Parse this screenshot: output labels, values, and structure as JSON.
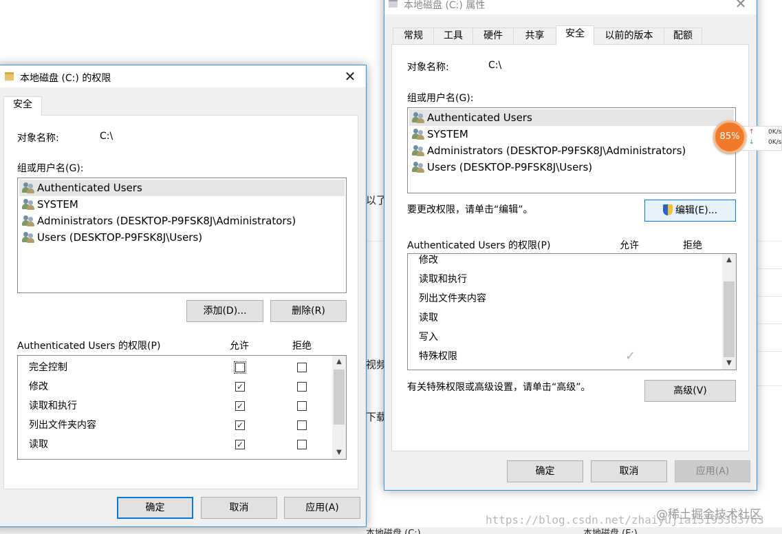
{
  "background": {
    "partial_texts": [
      "以了",
      "视频",
      "下载"
    ],
    "drives": [
      "本地磁盘 (C:)",
      "本地磁盘 (E:)"
    ],
    "watermark_url": "https://blog.csdn.net/zhaiyujia15195383763",
    "watermark_site": "@稀土掘金技术社区"
  },
  "network_widget": {
    "percent": "85%",
    "upload": "0K/s",
    "download": "0K/s",
    "up_arrow": "↑",
    "down_arrow": "↓"
  },
  "perm_dialog": {
    "title": "本地磁盘 (C:) 的权限",
    "close": "✕",
    "tab": "安全",
    "object_label": "对象名称:",
    "object_value": "C:\\",
    "group_label": "组或用户名(G):",
    "users": [
      "Authenticated Users",
      "SYSTEM",
      "Administrators (DESKTOP-P9FSK8J\\Administrators)",
      "Users (DESKTOP-P9FSK8J\\Users)"
    ],
    "add_button": "添加(D)...",
    "remove_button": "删除(R)",
    "perm_header": "Authenticated Users 的权限(P)",
    "allow_header": "允许",
    "deny_header": "拒绝",
    "permissions": [
      {
        "name": "完全控制",
        "allow": false,
        "deny": false
      },
      {
        "name": "修改",
        "allow": true,
        "deny": false
      },
      {
        "name": "读取和执行",
        "allow": true,
        "deny": false
      },
      {
        "name": "列出文件夹内容",
        "allow": true,
        "deny": false
      },
      {
        "name": "读取",
        "allow": true,
        "deny": false
      }
    ],
    "ok_button": "确定",
    "cancel_button": "取消",
    "apply_button": "应用(A)"
  },
  "props_dialog": {
    "title": "本地磁盘 (C:) 属性",
    "close": "✕",
    "tabs": [
      "常规",
      "工具",
      "硬件",
      "共享",
      "安全",
      "以前的版本",
      "配额"
    ],
    "active_tab": "安全",
    "object_label": "对象名称:",
    "object_value": "C:\\",
    "group_label": "组或用户名(G):",
    "users": [
      "Authenticated Users",
      "SYSTEM",
      "Administrators (DESKTOP-P9FSK8J\\Administrators)",
      "Users (DESKTOP-P9FSK8J\\Users)"
    ],
    "change_hint": "要更改权限，请单击“编辑”。",
    "edit_button": "编辑(E)...",
    "perm_header": "Authenticated Users 的权限(P)",
    "allow_header": "允许",
    "deny_header": "拒绝",
    "permissions": [
      {
        "name": "修改",
        "allow": false
      },
      {
        "name": "读取和执行",
        "allow": false
      },
      {
        "name": "列出文件夹内容",
        "allow": false
      },
      {
        "name": "读取",
        "allow": false
      },
      {
        "name": "写入",
        "allow": false
      },
      {
        "name": "特殊权限",
        "allow": true
      }
    ],
    "advanced_hint": "有关特殊权限或高级设置，请单击“高级”。",
    "advanced_button": "高级(V)",
    "ok_button": "确定",
    "cancel_button": "取消",
    "apply_button": "应用(A)"
  }
}
